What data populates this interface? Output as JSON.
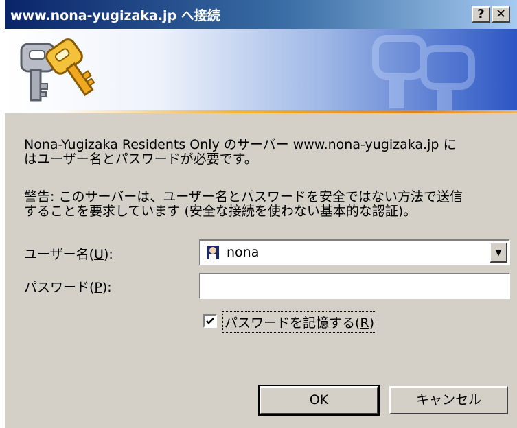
{
  "window": {
    "title": "www.nona-yugizaka.jp へ接続",
    "help_button": "?",
    "close_button": "✕"
  },
  "banner": {
    "icon": "keys-icon"
  },
  "message": {
    "line1": "Nona-Yugizaka Residents Only のサーバー www.nona-yugizaka.jp に",
    "line2": "はユーザー名とパスワードが必要です。"
  },
  "warning": {
    "line1": "警告: このサーバーは、ユーザー名とパスワードを安全ではない方法で送信",
    "line2": "することを要求しています (安全な接続を使わない基本的な認証)。"
  },
  "form": {
    "username_label": "ユーザー名(",
    "username_key": "U",
    "username_suffix": "):",
    "username_value": "nona",
    "password_label": "パスワード(",
    "password_key": "P",
    "password_suffix": "):",
    "password_value": "",
    "remember_label": "パスワードを記憶する(",
    "remember_key": "R",
    "remember_suffix": ")",
    "remember_checked": true
  },
  "buttons": {
    "ok": "OK",
    "cancel": "キャンセル"
  }
}
